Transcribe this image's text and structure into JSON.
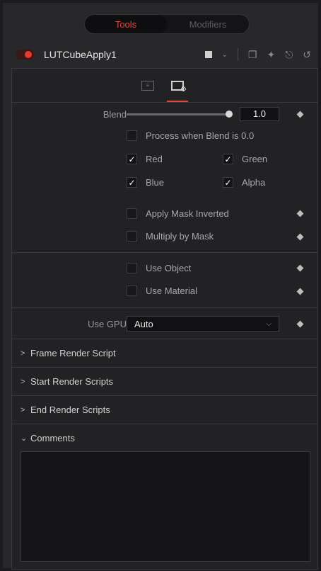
{
  "top_tabs": {
    "tools": "Tools",
    "modifiers": "Modifiers"
  },
  "tool": {
    "name": "LUTCubeApply1"
  },
  "settings": {
    "blend_label": "Blend",
    "blend_value": "1.0",
    "blend_level": 1.0,
    "process_when_blend_zero": {
      "label": "Process when Blend is 0.0",
      "checked": false
    },
    "channels": [
      {
        "label": "Red",
        "checked": true
      },
      {
        "label": "Green",
        "checked": true
      },
      {
        "label": "Blue",
        "checked": true
      },
      {
        "label": "Alpha",
        "checked": true
      }
    ],
    "apply_mask_inverted": {
      "label": "Apply Mask Inverted",
      "checked": false
    },
    "multiply_by_mask": {
      "label": "Multiply by Mask",
      "checked": false
    },
    "use_object": {
      "label": "Use Object",
      "checked": false
    },
    "use_material": {
      "label": "Use Material",
      "checked": false
    },
    "use_gpu_label": "Use GPU",
    "use_gpu_value": "Auto"
  },
  "sections": [
    {
      "label": "Frame Render Script",
      "expanded": false
    },
    {
      "label": "Start Render Scripts",
      "expanded": false
    },
    {
      "label": "End Render Scripts",
      "expanded": false
    },
    {
      "label": "Comments",
      "expanded": true
    }
  ],
  "colors": {
    "accent": "#e0483c",
    "active_toggle": "#e53b2f"
  },
  "icons": [
    "view-toggle-icon",
    "chevron-down-icon",
    "window-icon",
    "pin-icon",
    "lock-icon",
    "reset-icon",
    "sliders-tab-icon",
    "settings-tab-icon"
  ]
}
